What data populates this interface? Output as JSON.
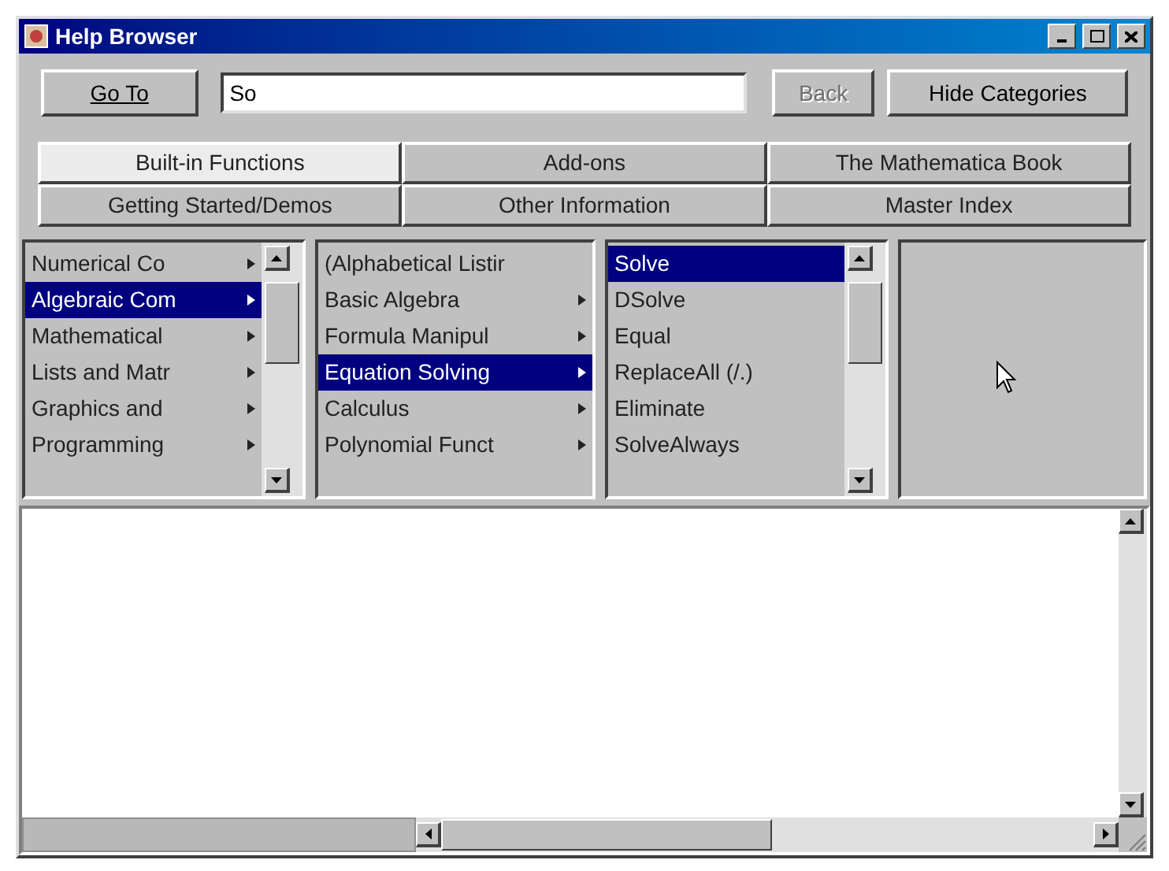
{
  "window": {
    "title": "Help Browser"
  },
  "toolbar": {
    "goto_button": "Go To",
    "search": {
      "value": "So"
    },
    "back_button": {
      "label": "Back",
      "disabled": true
    },
    "hide_button": "Hide Categories"
  },
  "tabs": [
    [
      {
        "label": "Built-in Functions",
        "selected": true
      },
      {
        "label": "Add-ons",
        "selected": false
      },
      {
        "label": "The Mathematica Book",
        "selected": false
      }
    ],
    [
      {
        "label": "Getting Started/Demos",
        "selected": false
      },
      {
        "label": "Other Information",
        "selected": false
      },
      {
        "label": "Master Index",
        "selected": false
      }
    ]
  ],
  "lists": [
    {
      "items": [
        {
          "label": "Numerical Co",
          "submenu": true,
          "selected": false
        },
        {
          "label": "Algebraic Com",
          "submenu": true,
          "selected": true
        },
        {
          "label": "Mathematical",
          "submenu": true,
          "selected": false
        },
        {
          "label": "Lists and Matr",
          "submenu": true,
          "selected": false
        },
        {
          "label": "Graphics and",
          "submenu": true,
          "selected": false
        },
        {
          "label": "Programming",
          "submenu": true,
          "selected": false
        }
      ]
    },
    {
      "items": [
        {
          "label": "(Alphabetical Listir",
          "submenu": false,
          "selected": false
        },
        {
          "label": "Basic Algebra",
          "submenu": true,
          "selected": false
        },
        {
          "label": "Formula Manipul",
          "submenu": true,
          "selected": false
        },
        {
          "label": "Equation Solving",
          "submenu": true,
          "selected": true
        },
        {
          "label": "Calculus",
          "submenu": true,
          "selected": false
        },
        {
          "label": "Polynomial Funct",
          "submenu": true,
          "selected": false
        }
      ]
    },
    {
      "items": [
        {
          "label": "Solve",
          "submenu": false,
          "selected": true
        },
        {
          "label": "DSolve",
          "submenu": false,
          "selected": false
        },
        {
          "label": "Equal",
          "submenu": false,
          "selected": false
        },
        {
          "label": "ReplaceAll (/.)",
          "submenu": false,
          "selected": false
        },
        {
          "label": "Eliminate",
          "submenu": false,
          "selected": false
        },
        {
          "label": "SolveAlways",
          "submenu": false,
          "selected": false
        }
      ]
    }
  ]
}
